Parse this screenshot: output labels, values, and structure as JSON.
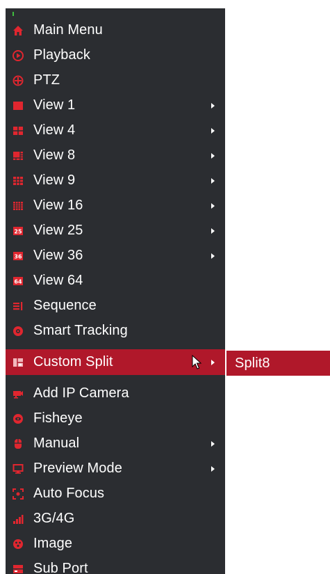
{
  "menu": {
    "items": [
      {
        "label": "Main Menu",
        "icon": "home-icon",
        "submenu": false
      },
      {
        "label": "Playback",
        "icon": "playback-icon",
        "submenu": false
      },
      {
        "label": "PTZ",
        "icon": "ptz-icon",
        "submenu": false
      },
      {
        "label": "View 1",
        "icon": "view1-icon",
        "submenu": true
      },
      {
        "label": "View 4",
        "icon": "view4-icon",
        "submenu": true
      },
      {
        "label": "View 8",
        "icon": "view8-icon",
        "submenu": true
      },
      {
        "label": "View 9",
        "icon": "view9-icon",
        "submenu": true
      },
      {
        "label": "View 16",
        "icon": "view16-icon",
        "submenu": true
      },
      {
        "label": "View 25",
        "icon": "view25-icon",
        "submenu": true
      },
      {
        "label": "View 36",
        "icon": "view36-icon",
        "submenu": true
      },
      {
        "label": "View 64",
        "icon": "view64-icon",
        "submenu": false
      },
      {
        "label": "Sequence",
        "icon": "sequence-icon",
        "submenu": false
      },
      {
        "label": "Smart Tracking",
        "icon": "smart-tracking-icon",
        "submenu": false
      },
      {
        "label": "Custom Split",
        "icon": "custom-split-icon",
        "submenu": true,
        "selected": true
      },
      {
        "label": "Add IP Camera",
        "icon": "add-ip-camera-icon",
        "submenu": false
      },
      {
        "label": "Fisheye",
        "icon": "fisheye-icon",
        "submenu": false
      },
      {
        "label": "Manual",
        "icon": "manual-icon",
        "submenu": true
      },
      {
        "label": "Preview Mode",
        "icon": "preview-mode-icon",
        "submenu": true
      },
      {
        "label": "Auto Focus",
        "icon": "auto-focus-icon",
        "submenu": false
      },
      {
        "label": "3G/4G",
        "icon": "signal-icon",
        "submenu": false
      },
      {
        "label": "Image",
        "icon": "image-icon",
        "submenu": false
      },
      {
        "label": "Sub Port",
        "icon": "sub-port-icon",
        "submenu": false
      }
    ]
  },
  "submenu": {
    "items": [
      {
        "label": "Split8"
      }
    ]
  },
  "colors": {
    "menu_bg": "#2b2d31",
    "accent": "#b0182a",
    "icon_red": "#e0262f",
    "text": "#ffffff"
  }
}
